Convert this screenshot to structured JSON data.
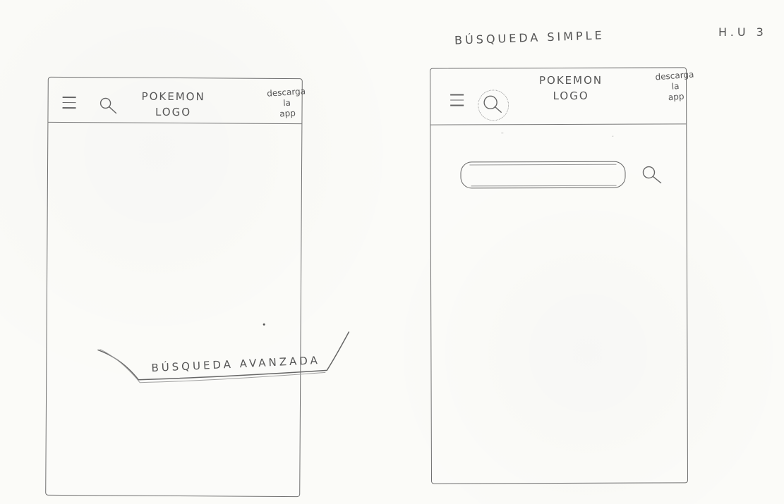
{
  "header": {
    "title": "BÚSQUEDA SIMPLE",
    "story": "H.U 3"
  },
  "left_mockup": {
    "logo_line1": "POKEMON",
    "logo_line2": "LOGO",
    "download_line1": "descarga",
    "download_line2": "la",
    "download_line3": "app",
    "advanced_search": "BÚSQUEDA AVANZADA"
  },
  "right_mockup": {
    "logo_line1": "POKEMON",
    "logo_line2": "LOGO",
    "download_line1": "descarga",
    "download_line2": "la",
    "download_line3": "app"
  },
  "icons": {
    "menu": "menu-icon",
    "search": "search-icon"
  }
}
